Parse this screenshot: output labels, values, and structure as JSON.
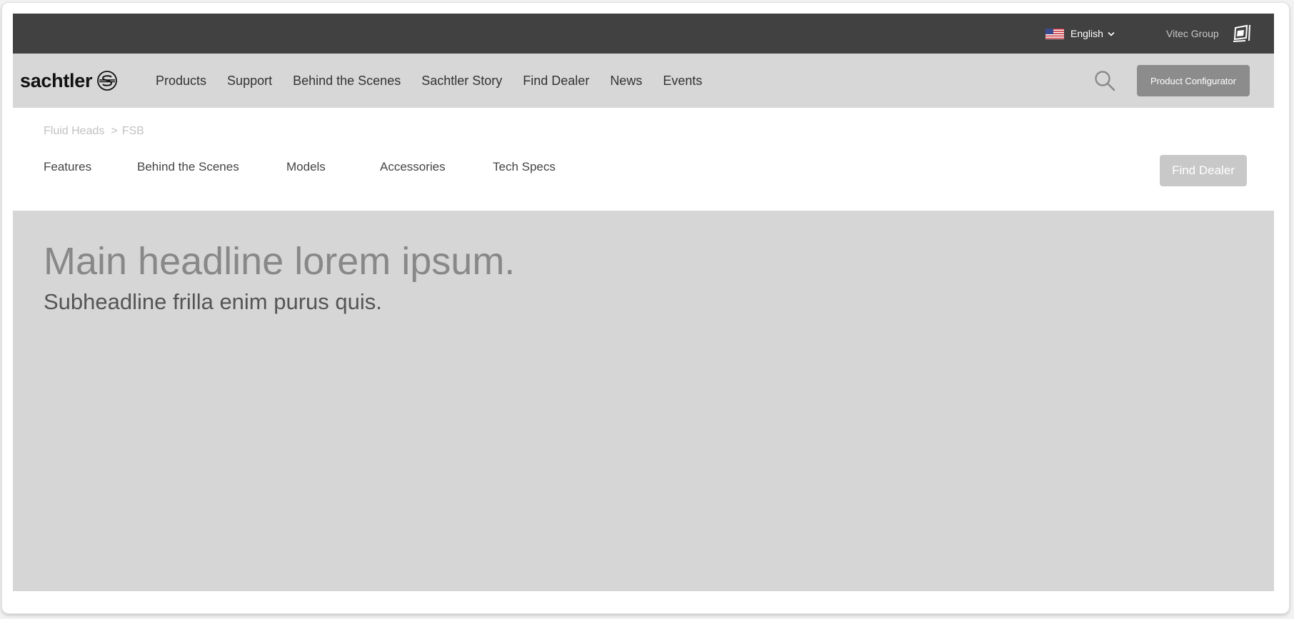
{
  "topbar": {
    "language": "English",
    "language_flag_icon": "us-flag-icon",
    "group_label": "Vitec Group"
  },
  "header": {
    "brand": "sachtler",
    "nav": [
      "Products",
      "Support",
      "Behind the Scenes",
      "Sachtler Story",
      "Find Dealer",
      "News",
      "Events"
    ],
    "configurator_label": "Product Configurator"
  },
  "breadcrumb": {
    "parent": "Fluid Heads",
    "separator": ">",
    "current": "FSB"
  },
  "subnav": {
    "items": [
      "Features",
      "Behind the Scenes",
      "Models",
      "Accessories",
      "Tech Specs"
    ],
    "find_dealer_label": "Find Dealer"
  },
  "hero": {
    "headline": "Main headline lorem ipsum.",
    "subheadline": "Subheadline frilla enim purus quis."
  },
  "colors": {
    "topbar_bg": "#414141",
    "navbar_bg": "#d7d7d7",
    "hero_bg": "#d6d6d6",
    "configurator_bg": "#8c8c8c",
    "find_dealer_bg": "#c8c8c8"
  }
}
